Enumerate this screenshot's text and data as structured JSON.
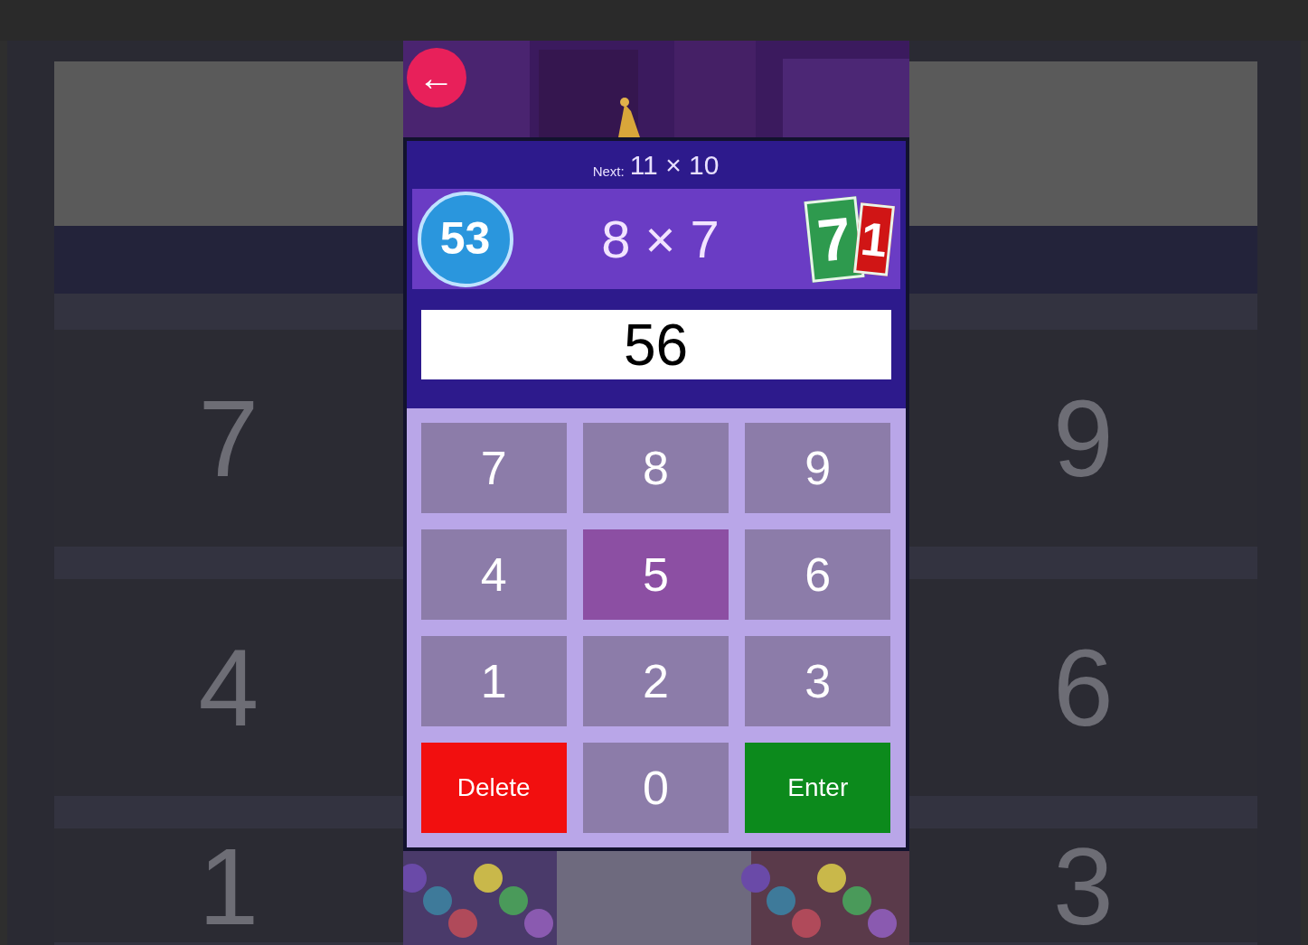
{
  "backdrop": {
    "left_keys": [
      "7",
      "4",
      "1"
    ],
    "right_keys": [
      "9",
      "6",
      "3"
    ]
  },
  "game": {
    "back_button": {
      "label": "←"
    },
    "next": {
      "label": "Next:",
      "value": "11 × 10"
    },
    "score": "53",
    "question": "8 × 7",
    "cards": [
      {
        "text": "7",
        "color": "#2e9a4e"
      },
      {
        "text": "1",
        "color": "#d01515"
      }
    ],
    "answer": "56",
    "keys": [
      {
        "label": "7",
        "kind": "digit",
        "selected": false
      },
      {
        "label": "8",
        "kind": "digit",
        "selected": false
      },
      {
        "label": "9",
        "kind": "digit",
        "selected": false
      },
      {
        "label": "4",
        "kind": "digit",
        "selected": false
      },
      {
        "label": "5",
        "kind": "digit",
        "selected": true
      },
      {
        "label": "6",
        "kind": "digit",
        "selected": false
      },
      {
        "label": "1",
        "kind": "digit",
        "selected": false
      },
      {
        "label": "2",
        "kind": "digit",
        "selected": false
      },
      {
        "label": "3",
        "kind": "digit",
        "selected": false
      },
      {
        "label": "Delete",
        "kind": "delete",
        "selected": false
      },
      {
        "label": "0",
        "kind": "digit",
        "selected": false
      },
      {
        "label": "Enter",
        "kind": "enter",
        "selected": false
      }
    ]
  }
}
